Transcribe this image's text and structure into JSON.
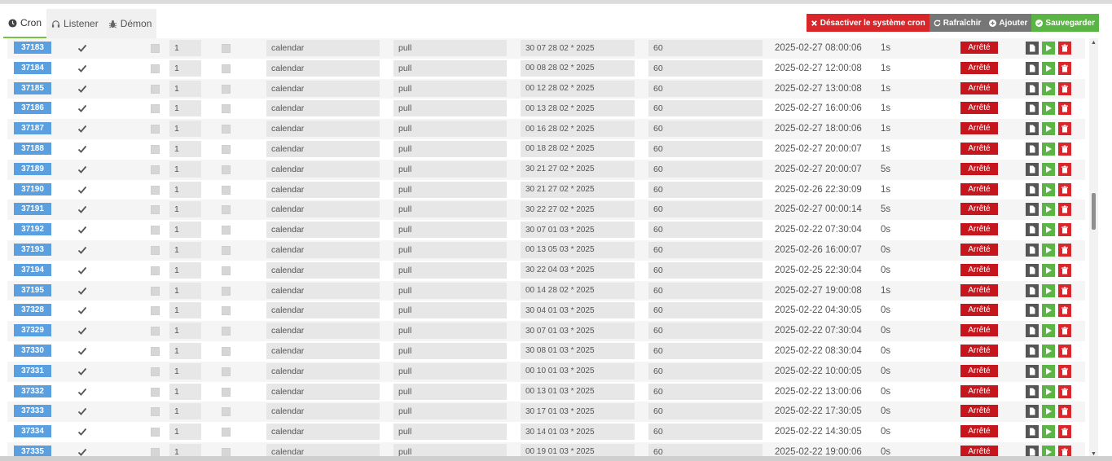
{
  "tabs": [
    {
      "label": "Cron",
      "icon": "clock-icon",
      "active": true
    },
    {
      "label": "Listener",
      "icon": "headset-icon",
      "active": false
    },
    {
      "label": "Démon",
      "icon": "bug-icon",
      "active": false
    }
  ],
  "actions": {
    "disable": "Désactiver le système cron",
    "refresh": "Rafraîchir",
    "add": "Ajouter",
    "save": "Sauvegarder"
  },
  "colors": {
    "id_button": "#5a9fdf",
    "state_stopped": "#c4161c",
    "disable_button": "#d9262a",
    "save_button": "#5bb544",
    "active_tab_underline": "#7ac143"
  },
  "rows": [
    {
      "id": "37183",
      "num": "1",
      "class": "calendar",
      "func": "pull",
      "cron": "30 07 28 02 * 2025",
      "timeout": "60",
      "lastrun": "2025-02-27 08:00:06",
      "duration": "1s",
      "state": "Arrêté"
    },
    {
      "id": "37184",
      "num": "1",
      "class": "calendar",
      "func": "pull",
      "cron": "00 08 28 02 * 2025",
      "timeout": "60",
      "lastrun": "2025-02-27 12:00:08",
      "duration": "1s",
      "state": "Arrêté"
    },
    {
      "id": "37185",
      "num": "1",
      "class": "calendar",
      "func": "pull",
      "cron": "00 12 28 02 * 2025",
      "timeout": "60",
      "lastrun": "2025-02-27 13:00:08",
      "duration": "1s",
      "state": "Arrêté"
    },
    {
      "id": "37186",
      "num": "1",
      "class": "calendar",
      "func": "pull",
      "cron": "00 13 28 02 * 2025",
      "timeout": "60",
      "lastrun": "2025-02-27 16:00:06",
      "duration": "1s",
      "state": "Arrêté"
    },
    {
      "id": "37187",
      "num": "1",
      "class": "calendar",
      "func": "pull",
      "cron": "00 16 28 02 * 2025",
      "timeout": "60",
      "lastrun": "2025-02-27 18:00:06",
      "duration": "1s",
      "state": "Arrêté"
    },
    {
      "id": "37188",
      "num": "1",
      "class": "calendar",
      "func": "pull",
      "cron": "00 18 28 02 * 2025",
      "timeout": "60",
      "lastrun": "2025-02-27 20:00:07",
      "duration": "1s",
      "state": "Arrêté"
    },
    {
      "id": "37189",
      "num": "1",
      "class": "calendar",
      "func": "pull",
      "cron": "30 21 27 02 * 2025",
      "timeout": "60",
      "lastrun": "2025-02-27 20:00:07",
      "duration": "5s",
      "state": "Arrêté"
    },
    {
      "id": "37190",
      "num": "1",
      "class": "calendar",
      "func": "pull",
      "cron": "30 21 27 02 * 2025",
      "timeout": "60",
      "lastrun": "2025-02-26 22:30:09",
      "duration": "1s",
      "state": "Arrêté"
    },
    {
      "id": "37191",
      "num": "1",
      "class": "calendar",
      "func": "pull",
      "cron": "30 22 27 02 * 2025",
      "timeout": "60",
      "lastrun": "2025-02-27 00:00:14",
      "duration": "5s",
      "state": "Arrêté"
    },
    {
      "id": "37192",
      "num": "1",
      "class": "calendar",
      "func": "pull",
      "cron": "30 07 01 03 * 2025",
      "timeout": "60",
      "lastrun": "2025-02-22 07:30:04",
      "duration": "0s",
      "state": "Arrêté"
    },
    {
      "id": "37193",
      "num": "1",
      "class": "calendar",
      "func": "pull",
      "cron": "00 13 05 03 * 2025",
      "timeout": "60",
      "lastrun": "2025-02-26 16:00:07",
      "duration": "0s",
      "state": "Arrêté"
    },
    {
      "id": "37194",
      "num": "1",
      "class": "calendar",
      "func": "pull",
      "cron": "30 22 04 03 * 2025",
      "timeout": "60",
      "lastrun": "2025-02-25 22:30:04",
      "duration": "0s",
      "state": "Arrêté"
    },
    {
      "id": "37195",
      "num": "1",
      "class": "calendar",
      "func": "pull",
      "cron": "00 14 28 02 * 2025",
      "timeout": "60",
      "lastrun": "2025-02-27 19:00:08",
      "duration": "1s",
      "state": "Arrêté"
    },
    {
      "id": "37328",
      "num": "1",
      "class": "calendar",
      "func": "pull",
      "cron": "30 04 01 03 * 2025",
      "timeout": "60",
      "lastrun": "2025-02-22 04:30:05",
      "duration": "0s",
      "state": "Arrêté"
    },
    {
      "id": "37329",
      "num": "1",
      "class": "calendar",
      "func": "pull",
      "cron": "30 07 01 03 * 2025",
      "timeout": "60",
      "lastrun": "2025-02-22 07:30:04",
      "duration": "0s",
      "state": "Arrêté"
    },
    {
      "id": "37330",
      "num": "1",
      "class": "calendar",
      "func": "pull",
      "cron": "30 08 01 03 * 2025",
      "timeout": "60",
      "lastrun": "2025-02-22 08:30:04",
      "duration": "0s",
      "state": "Arrêté"
    },
    {
      "id": "37331",
      "num": "1",
      "class": "calendar",
      "func": "pull",
      "cron": "00 10 01 03 * 2025",
      "timeout": "60",
      "lastrun": "2025-02-22 10:00:05",
      "duration": "0s",
      "state": "Arrêté"
    },
    {
      "id": "37332",
      "num": "1",
      "class": "calendar",
      "func": "pull",
      "cron": "00 13 01 03 * 2025",
      "timeout": "60",
      "lastrun": "2025-02-22 13:00:06",
      "duration": "0s",
      "state": "Arrêté"
    },
    {
      "id": "37333",
      "num": "1",
      "class": "calendar",
      "func": "pull",
      "cron": "30 17 01 03 * 2025",
      "timeout": "60",
      "lastrun": "2025-02-22 17:30:05",
      "duration": "0s",
      "state": "Arrêté"
    },
    {
      "id": "37334",
      "num": "1",
      "class": "calendar",
      "func": "pull",
      "cron": "30 14 01 03 * 2025",
      "timeout": "60",
      "lastrun": "2025-02-22 14:30:05",
      "duration": "0s",
      "state": "Arrêté"
    },
    {
      "id": "37335",
      "num": "1",
      "class": "calendar",
      "func": "pull",
      "cron": "00 19 01 03 * 2025",
      "timeout": "60",
      "lastrun": "2025-02-22 19:00:06",
      "duration": "0s",
      "state": "Arrêté"
    }
  ]
}
